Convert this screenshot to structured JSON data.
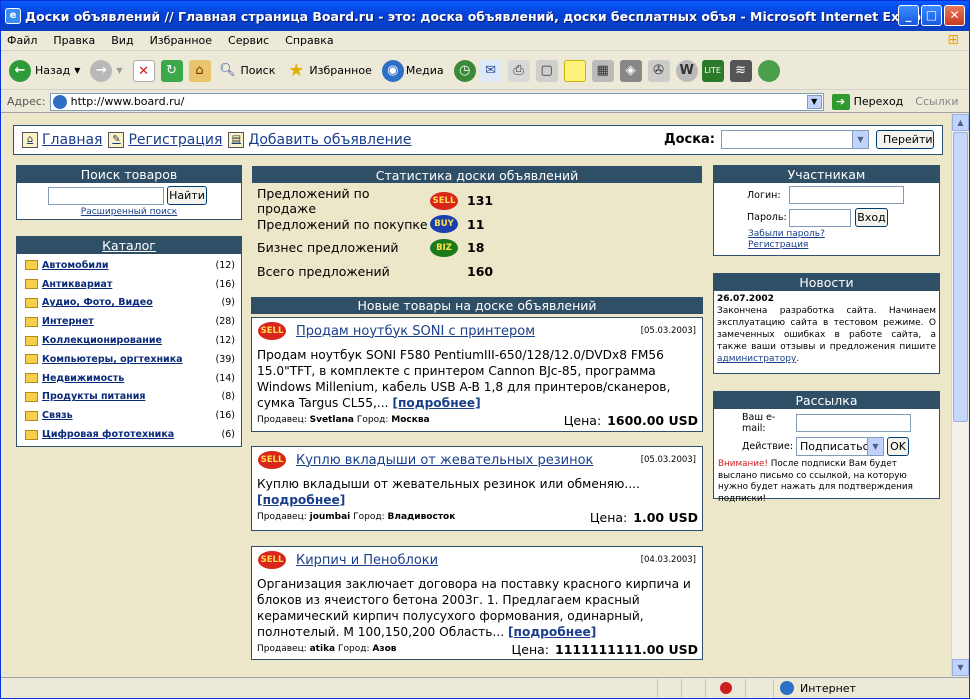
{
  "window": {
    "title": "Доски объявлений // Главная страница    Board.ru - это: доска объявлений, доски бесплатных объя - Microsoft Internet Explorer"
  },
  "menu": [
    "Файл",
    "Правка",
    "Вид",
    "Избранное",
    "Сервис",
    "Справка"
  ],
  "toolbar": {
    "back": "Назад",
    "search": "Поиск",
    "favorites": "Избранное",
    "media": "Медиа"
  },
  "address": {
    "label": "Адрес:",
    "url": "http://www.board.ru/",
    "go": "Переход",
    "links": "Ссылки"
  },
  "status": {
    "zone": "Интернет"
  },
  "topnav": {
    "home": "Главная",
    "register": "Регистрация",
    "add": "Добавить объявление",
    "board_label": "Доска:",
    "go": "Перейти"
  },
  "search": {
    "header": "Поиск товаров",
    "button": "Найти",
    "advanced": "Расширенный поиск"
  },
  "catalog": {
    "header": "Каталог",
    "items": [
      {
        "name": "Автомобили",
        "count": "(12)"
      },
      {
        "name": "Антиквариат",
        "count": "(16)"
      },
      {
        "name": "Аудио, Фото, Видео",
        "count": "(9)"
      },
      {
        "name": "Интернет",
        "count": "(28)"
      },
      {
        "name": "Коллекционирование",
        "count": "(12)"
      },
      {
        "name": "Компьютеры, оргтехника",
        "count": "(39)"
      },
      {
        "name": "Недвижимость",
        "count": "(14)"
      },
      {
        "name": "Продукты питания",
        "count": "(8)"
      },
      {
        "name": "Связь",
        "count": "(16)"
      },
      {
        "name": "Цифровая фототехника",
        "count": "(6)"
      }
    ]
  },
  "stats": {
    "header": "Статистика доски объявлений",
    "rows": [
      {
        "label": "Предложений по продаже",
        "badge": "SELL",
        "value": "131"
      },
      {
        "label": "Предложений по покупке",
        "badge": "BUY",
        "value": "11"
      },
      {
        "label": "Бизнес предложений",
        "badge": "BIZ",
        "value": "18"
      },
      {
        "label": "Всего предложений",
        "badge": "",
        "value": "160"
      }
    ]
  },
  "new_items": {
    "header": "Новые товары на доске объявлений",
    "items": [
      {
        "badge": "SELL",
        "title": "Продам ноутбук SONI с принтером",
        "date": "[05.03.2003]",
        "desc": "Продам ноутбук SONI F580 PentiumIII-650/128/12.0/DVDx8 FM56 15.0\"TFT, в комплекте с принтером Cannon BJc-85, программа Windows Millenium, кабель USB A-B 1,8 для принтеров/сканеров, сумка Targus CL55,...",
        "more": "[подробнее]",
        "seller_label": "Продавец:",
        "seller": "Svetlana",
        "city_label": "Город:",
        "city": "Москва",
        "price_label": "Цена:",
        "price": "1600.00 USD"
      },
      {
        "badge": "SELL",
        "title": "Куплю вкладыши от жевательных резинок",
        "date": "[05.03.2003]",
        "desc": "Куплю вкладыши от жевательных резинок или обменяю....",
        "more": "[подробнее]",
        "seller_label": "Продавец:",
        "seller": "joumbai",
        "city_label": "Город:",
        "city": "Владивосток",
        "price_label": "Цена:",
        "price": "1.00 USD"
      },
      {
        "badge": "SELL",
        "title": "Кирпич и Пеноблоки",
        "date": "[04.03.2003]",
        "desc": "Организация заключает договора на поставку красного кирпича и блоков из ячеистого бетона 2003г. 1. Предлагаем красный керамический кирпич полусухого формования, одинарный, полнотелый. М 100,150,200 Область...",
        "more": "[подробнее]",
        "seller_label": "Продавец:",
        "seller": "atika",
        "city_label": "Город:",
        "city": "Азов",
        "price_label": "Цена:",
        "price": "1111111111.00 USD"
      }
    ]
  },
  "members": {
    "header": "Участникам",
    "login": "Логин:",
    "password": "Пароль:",
    "enter": "Вход",
    "forgot": "Забыли пароль?",
    "register": "Регистрация"
  },
  "news": {
    "header": "Новости",
    "date": "26.07.2002",
    "text": "Закончена разработка сайта. Начинаем эксплуатацию сайта в тестовом режиме. О замеченных ошибках в работе сайта, а также ваши отзывы и предложения пишите",
    "link": "администратору",
    "end": "."
  },
  "mailing": {
    "header": "Рассылка",
    "email": "Ваш e-mail:",
    "action": "Действие:",
    "action_value": "Подписаться",
    "ok": "OK",
    "note_red": "Внимание!",
    "note": "После подписки Вам будет выслано письмо со ссылкой, на которую нужно будет нажать для подтверждения подписки!"
  }
}
